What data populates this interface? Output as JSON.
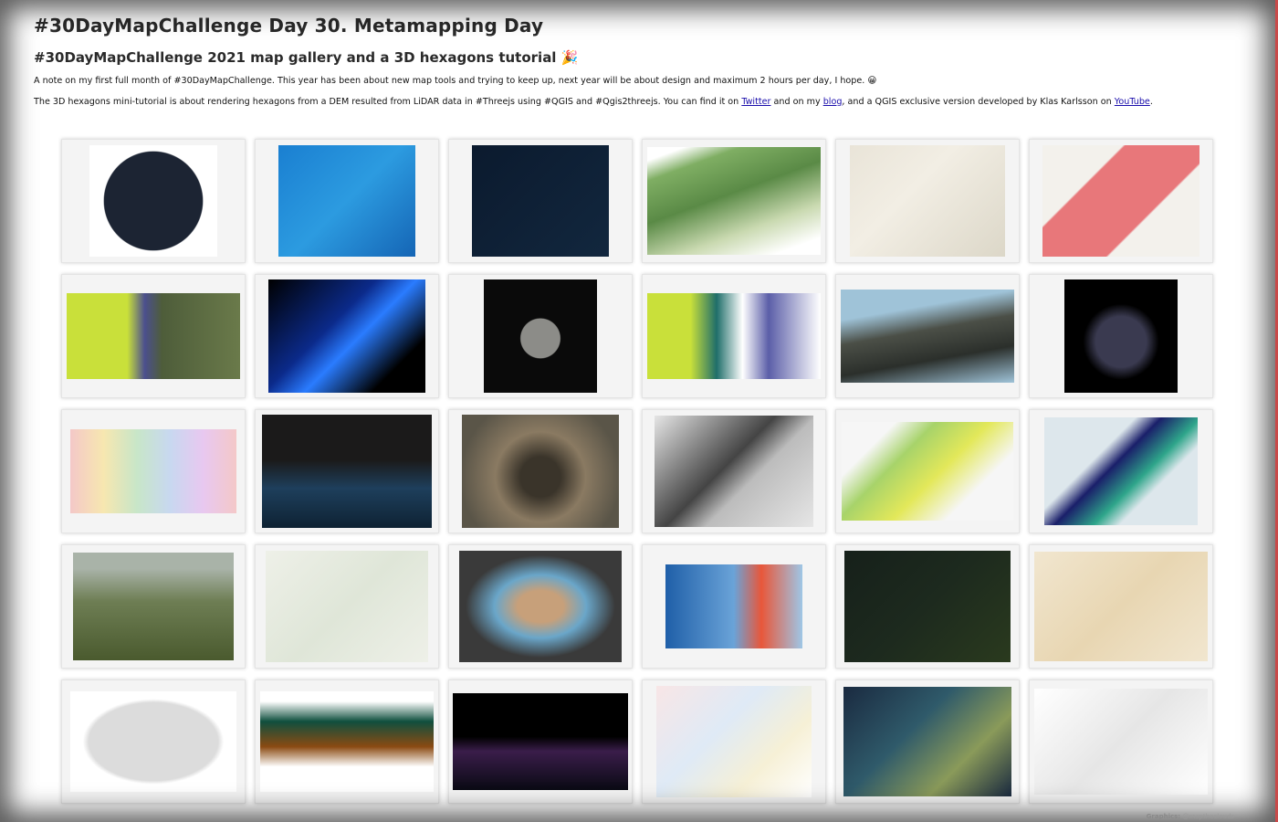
{
  "title": "#30DayMapChallenge Day 30. Metamapping Day",
  "subtitle": "#30DayMapChallenge 2021 map gallery and a 3D hexagons tutorial",
  "subtitle_emoji": "🎉",
  "note1": "A note on my first full month of #30DayMapChallenge. This year has been about new map tools and trying to keep up, next year will be about design and maximum 2 hours per day, I hope. 😀",
  "note2_a": "The 3D hexagons mini-tutorial is about rendering hexagons from a DEM resulted from LiDAR data in #Threejs using #QGIS and #Qgis2threejs. You can find it on ",
  "link_twitter": "Twitter",
  "note2_b": " and on my ",
  "link_blog": "blog",
  "note2_c": ", and a QGIS exclusive version developed by Klas Karlsson on ",
  "link_youtube": "YouTube",
  "note2_d": ".",
  "credit_label": "Graphics:",
  "credit_handle": "@maptheclouds",
  "gallery": [
    "globe-night-lights",
    "blue-streams-map",
    "dark-urban-blocks",
    "3d-green-mountain",
    "street-map-city",
    "red-dot-density",
    "landcover-yellow-compare",
    "blue-reservoir",
    "moon",
    "landcover-3d-tilted",
    "3d-dark-terrain",
    "glowing-globe",
    "world-timezones",
    "3d-night-city",
    "satellite-crater",
    "black-buildings-city",
    "romania-green-choropleth",
    "purple-lake-map",
    "aerial-terrain-view",
    "route-map-popup",
    "romania-elevation",
    "romania-blue-counties",
    "romania-night-dots",
    "historic-map-sepia",
    "grey-romania-counties",
    "world-choropleth",
    "world-dark-maps",
    "projection-collage",
    "3d-terrain-panels",
    "gallery-mosaic"
  ],
  "colors": {
    "link": "#1a0dab",
    "frame_shadow": "#000000",
    "right_border": "#c94a4a",
    "card_bg": "#f4f4f4"
  }
}
